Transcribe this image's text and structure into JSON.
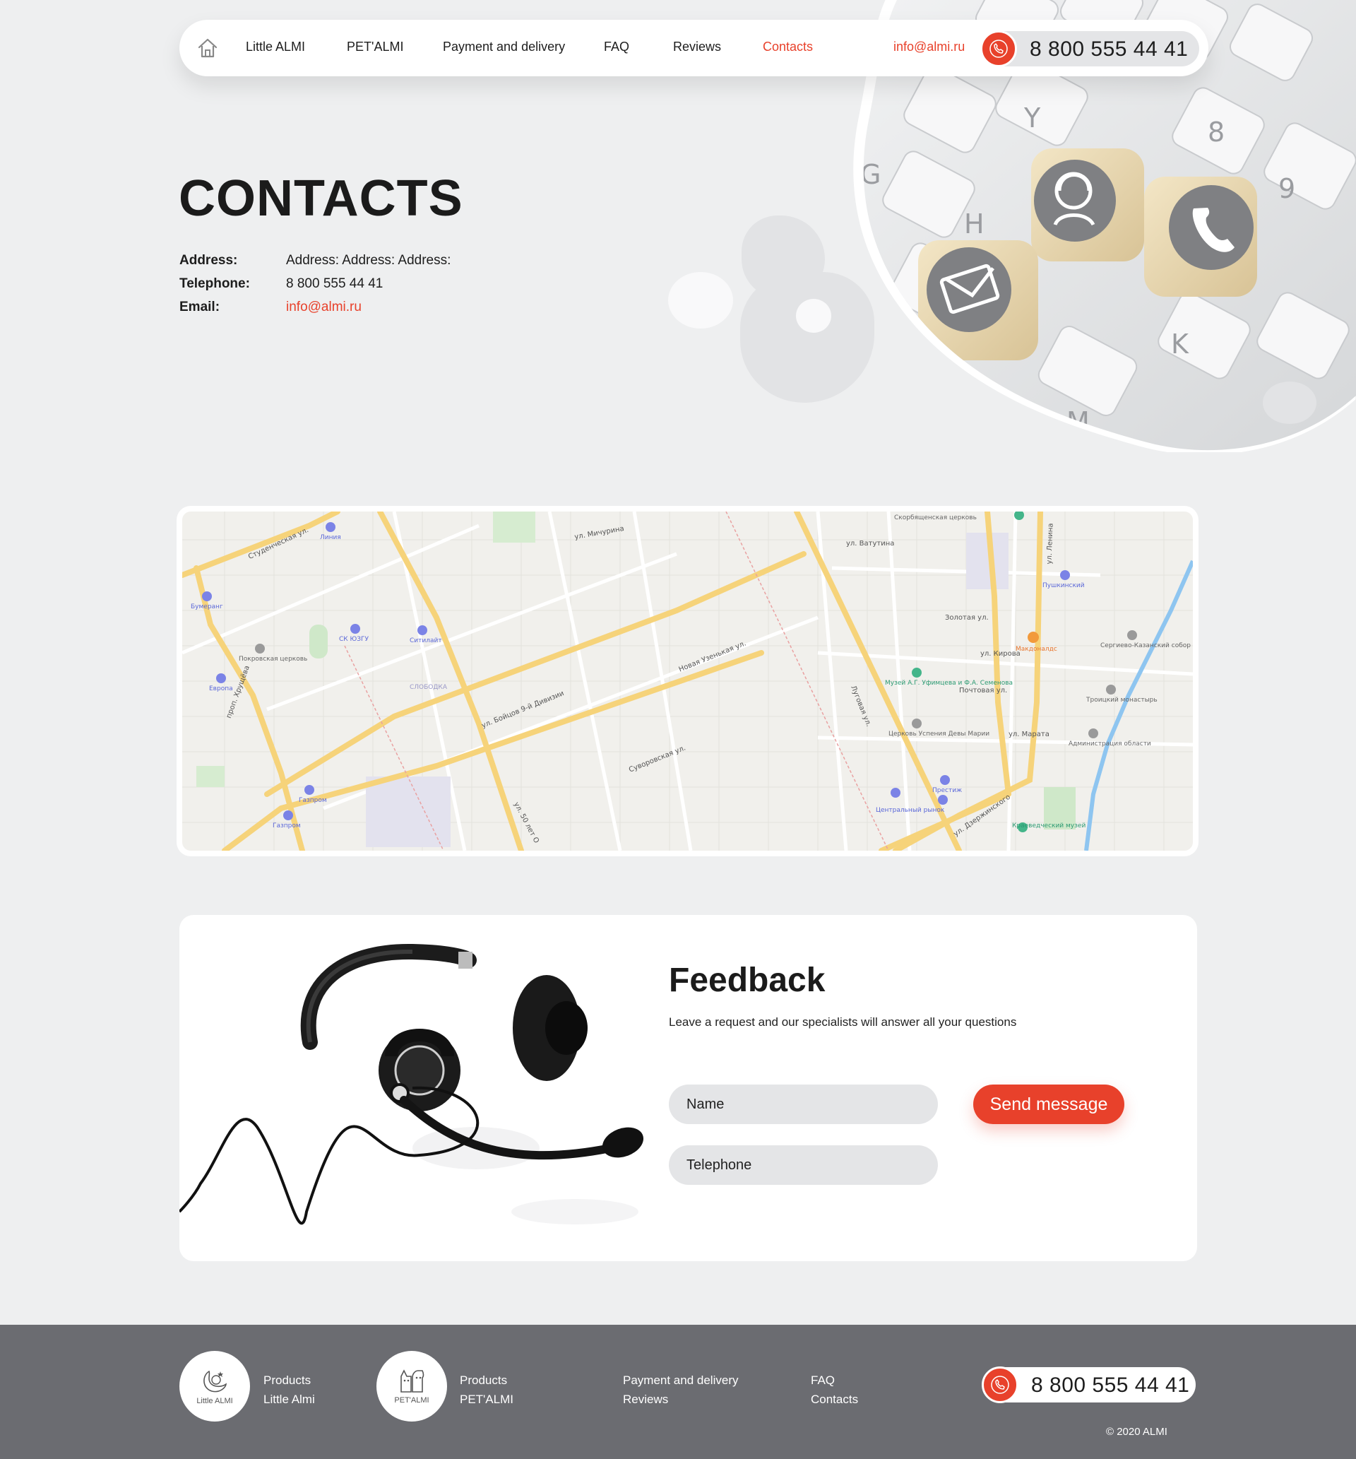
{
  "header": {
    "nav": [
      {
        "label": "Little ALMI"
      },
      {
        "label": "PET'ALMI"
      },
      {
        "label": "Payment and delivery"
      },
      {
        "label": "FAQ"
      },
      {
        "label": "Reviews"
      },
      {
        "label": "Contacts",
        "active": true
      }
    ],
    "email": "info@almi.ru",
    "phone": "8 800 555 44 41"
  },
  "contacts": {
    "title": "CONTACTS",
    "address_label": "Address:",
    "address_value": "Address: Address: Address:",
    "telephone_label": "Telephone:",
    "telephone_value": "8 800 555 44 41",
    "email_label": "Email:",
    "email_value": "info@almi.ru"
  },
  "map": {
    "labels": {
      "street1": "ул. Бойцов 9-й Дивизии",
      "street2": "Суворовская ул.",
      "street3": "ул. 50 лет О",
      "street4": "ул. Ленина",
      "street5": "ул. Дзержинского",
      "street6": "Студенческая ул.",
      "street7": "Луговая ул.",
      "street8": "ул. Кирова",
      "street9": "Почтовая ул.",
      "street10": "ул. Марата",
      "street11": "проп. Хрущёва",
      "street12": "Золотая ул.",
      "street13": "ул. Ватутина",
      "street14": "Новая Узенькая ул.",
      "street15": "ул. Мичурина"
    },
    "pois": {
      "poi1": "Линия",
      "poi2": "Бумеранг",
      "poi3": "СК ЮЗГУ",
      "poi4": "Ситилайт",
      "poi5": "Покровская церковь",
      "poi6": "Европа",
      "poi7": "Газпром",
      "poi8": "Газпром",
      "poi9": "Пушкинский",
      "poi10": "Макдоналдс",
      "poi11": "Сергиево-Казанский собор",
      "poi12": "Музей А.Г. Уфимцева и Ф.А. Семенова",
      "poi13": "Церковь Успения Девы Марии",
      "poi14": "Троицкий монастырь",
      "poi15": "Администрация области",
      "poi16": "Престиж",
      "poi17": "Центральный рынок",
      "poi18": "Краеведческий музей",
      "poi19": "Скорбященская церковь",
      "poi20": "СЛОБОДКА"
    }
  },
  "feedback": {
    "title": "Feedback",
    "subtitle": "Leave a request and our specialists will answer all your questions",
    "name_placeholder": "Name",
    "telephone_placeholder": "Telephone",
    "button_label": "Send message"
  },
  "footer": {
    "logo1_text": "Little ALMI",
    "logo2_text": "PET'ALMI",
    "col1_line1": "Products",
    "col1_line2": "Little Almi",
    "col2_line1": "Products",
    "col2_line2": "PET'ALMI",
    "col3_line1": "Payment and delivery",
    "col3_line2": "Reviews",
    "col4_line1": "FAQ",
    "col4_line2": "Contacts",
    "phone": "8 800 555 44 41",
    "copyright": "© 2020 ALMI"
  },
  "colors": {
    "accent": "#e8412b",
    "background": "#eeeff0",
    "footer": "#6b6c71",
    "pill": "#e4e5e7"
  },
  "icons": {
    "home": "home-icon",
    "phone": "phone-icon",
    "email_die": "envelope-icon",
    "support_die": "operator-icon",
    "call_die": "handset-icon"
  }
}
